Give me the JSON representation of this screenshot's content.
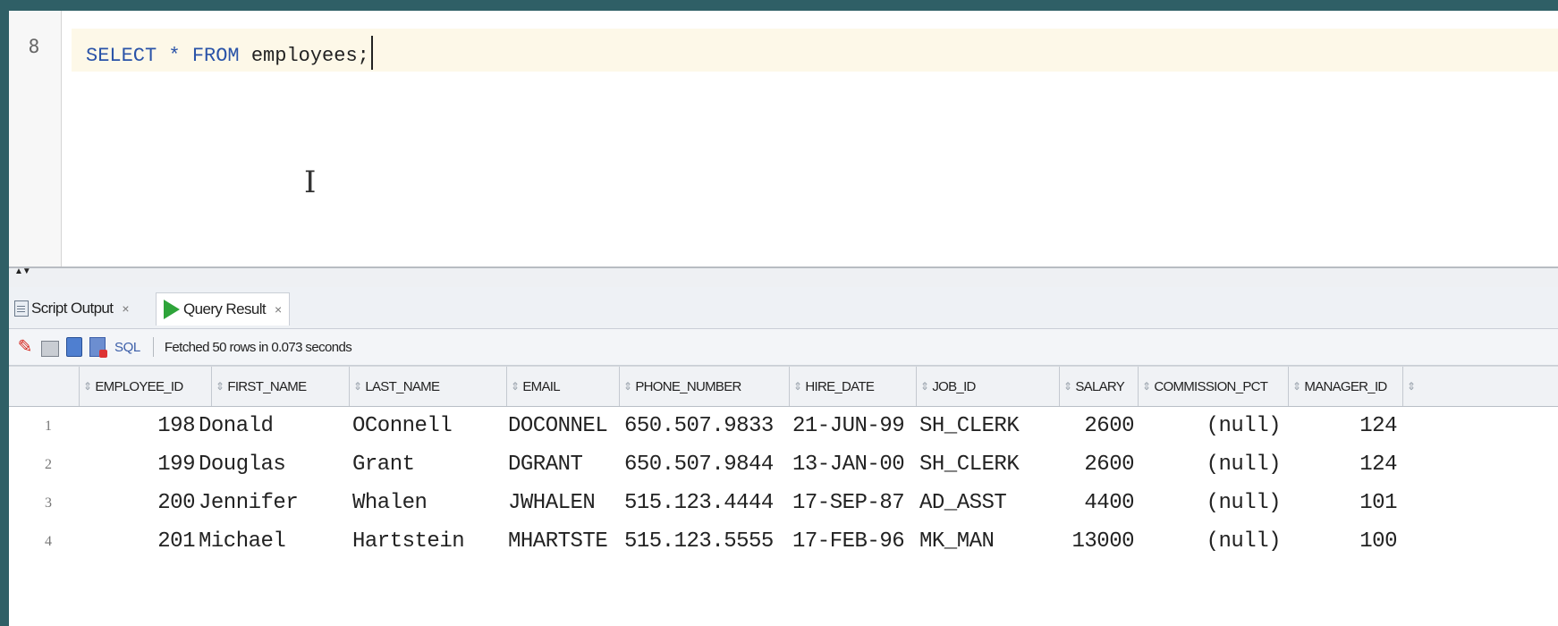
{
  "editor": {
    "line_number": "8",
    "code": {
      "kw_select": "SELECT",
      "star": "*",
      "kw_from": "FROM",
      "table": "employees;"
    },
    "cursor": "I"
  },
  "splitter": {
    "arrows": "▲▼"
  },
  "tabs": [
    {
      "label": "Script Output",
      "close": "×",
      "icon": "document-icon"
    },
    {
      "label": "Query Result",
      "close": "×",
      "icon": "play-icon"
    }
  ],
  "toolbar": {
    "icons": [
      "pin-icon",
      "print-icon",
      "export-icon",
      "refresh-icon"
    ],
    "sql_label": "SQL",
    "status": "Fetched 50 rows in 0.073 seconds"
  },
  "grid": {
    "columns": [
      "EMPLOYEE_ID",
      "FIRST_NAME",
      "LAST_NAME",
      "EMAIL",
      "PHONE_NUMBER",
      "HIRE_DATE",
      "JOB_ID",
      "SALARY",
      "COMMISSION_PCT",
      "MANAGER_ID"
    ],
    "rows": [
      {
        "n": "1",
        "employee_id": "198",
        "first_name": "Donald",
        "last_name": "OConnell",
        "email": "DOCONNEL",
        "phone_number": "650.507.9833",
        "hire_date": "21-JUN-99",
        "job_id": "SH_CLERK",
        "salary": "2600",
        "commission_pct": "(null)",
        "manager_id": "124"
      },
      {
        "n": "2",
        "employee_id": "199",
        "first_name": "Douglas",
        "last_name": "Grant",
        "email": "DGRANT",
        "phone_number": "650.507.9844",
        "hire_date": "13-JAN-00",
        "job_id": "SH_CLERK",
        "salary": "2600",
        "commission_pct": "(null)",
        "manager_id": "124"
      },
      {
        "n": "3",
        "employee_id": "200",
        "first_name": "Jennifer",
        "last_name": "Whalen",
        "email": "JWHALEN",
        "phone_number": "515.123.4444",
        "hire_date": "17-SEP-87",
        "job_id": "AD_ASST",
        "salary": "4400",
        "commission_pct": "(null)",
        "manager_id": "101"
      },
      {
        "n": "4",
        "employee_id": "201",
        "first_name": "Michael",
        "last_name": "Hartstein",
        "email": "MHARTSTE",
        "phone_number": "515.123.5555",
        "hire_date": "17-FEB-96",
        "job_id": "MK_MAN",
        "salary": "13000",
        "commission_pct": "(null)",
        "manager_id": "100"
      }
    ]
  }
}
